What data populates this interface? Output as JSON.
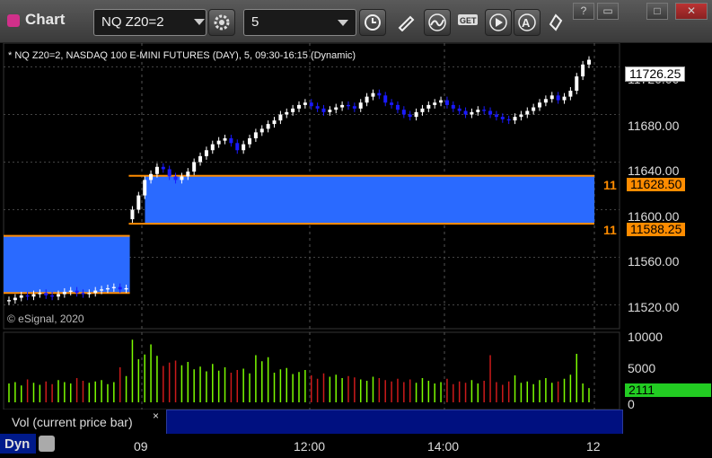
{
  "window": {
    "title": "Chart"
  },
  "toolbar": {
    "symbol": "NQ Z20=2",
    "interval": "5",
    "icons": [
      "gear-icon",
      "clock-icon",
      "pencil-icon",
      "curve-icon",
      "get-icon",
      "play-icon",
      "alert-icon",
      "pointer-icon"
    ]
  },
  "window_controls": {
    "help": "?",
    "restore": "▭",
    "maximize": "□",
    "close": "✕"
  },
  "chart": {
    "header": "* NQ Z20=2, NASDAQ 100 E-MINI FUTURES (DAY), 5, 09:30-16:15 (Dynamic)",
    "copyright": "© eSignal, 2020",
    "price_ticks": [
      "11720.00",
      "11680.00",
      "11640.00",
      "11600.00",
      "11560.00",
      "11520.00"
    ],
    "current_price": "11726.25",
    "level_upper": "11628.50",
    "level_lower": "11588.25",
    "level_short_upper": "11",
    "level_short_lower": "11",
    "volume_ticks": [
      "10000",
      "5000",
      "0"
    ],
    "current_volume": "2111",
    "volume_label": "Vol (current price bar)",
    "close_symbol": "×",
    "time_labels": [
      "09",
      "12:00",
      "14:00",
      "12"
    ],
    "mode_label": "Dyn",
    "colors": {
      "up": "#ffffff",
      "down": "#1a1aff",
      "zone": "#2a6aff",
      "level": "#ff8c00",
      "vol_up": "#7cfc00",
      "vol_down": "#cc1a1a",
      "vol_tag": "#22cc22"
    }
  },
  "chart_data": {
    "type": "candlestick",
    "ylim": [
      11500,
      11740
    ],
    "closes": [
      11524,
      11526,
      11528,
      11527,
      11529,
      11530,
      11528,
      11527,
      11529,
      11531,
      11532,
      11530,
      11529,
      11530,
      11532,
      11533,
      11534,
      11535,
      11533,
      11534,
      11600,
      11612,
      11625,
      11630,
      11636,
      11634,
      11628,
      11625,
      11628,
      11632,
      11640,
      11645,
      11650,
      11655,
      11658,
      11660,
      11656,
      11650,
      11655,
      11660,
      11665,
      11668,
      11672,
      11675,
      11680,
      11682,
      11685,
      11688,
      11690,
      11687,
      11685,
      11682,
      11684,
      11686,
      11688,
      11687,
      11685,
      11690,
      11695,
      11698,
      11696,
      11690,
      11688,
      11684,
      11680,
      11678,
      11682,
      11685,
      11688,
      11690,
      11692,
      11688,
      11685,
      11683,
      11680,
      11682,
      11684,
      11683,
      11680,
      11678,
      11676,
      11675,
      11678,
      11680,
      11683,
      11686,
      11690,
      11693,
      11696,
      11692,
      11695,
      11700,
      11712,
      11722,
      11726
    ],
    "volumes": [
      2800,
      3000,
      2500,
      3400,
      2900,
      2600,
      3100,
      2700,
      3300,
      3000,
      2800,
      3600,
      3200,
      2900,
      3100,
      3300,
      2700,
      3000,
      5200,
      3900,
      9300,
      6400,
      7100,
      8600,
      6900,
      5400,
      5900,
      6200,
      5500,
      6000,
      4900,
      5300,
      4600,
      5700,
      4700,
      5200,
      4400,
      4800,
      5000,
      4300,
      7000,
      6100,
      6700,
      4400,
      4900,
      5100,
      4200,
      4500,
      4800,
      4000,
      3500,
      4300,
      3800,
      4100,
      3600,
      3900,
      3700,
      3400,
      3200,
      3800,
      3600,
      3300,
      3100,
      3500,
      3000,
      3400,
      2900,
      3600,
      3200,
      2800,
      3000,
      3500,
      2700,
      3100,
      2900,
      3300,
      2800,
      3200,
      7000,
      3000,
      2600,
      3100,
      4000,
      2900,
      3100,
      2700,
      3300,
      3600,
      2900,
      3100,
      3500,
      4100,
      7200,
      2800,
      2111
    ]
  }
}
